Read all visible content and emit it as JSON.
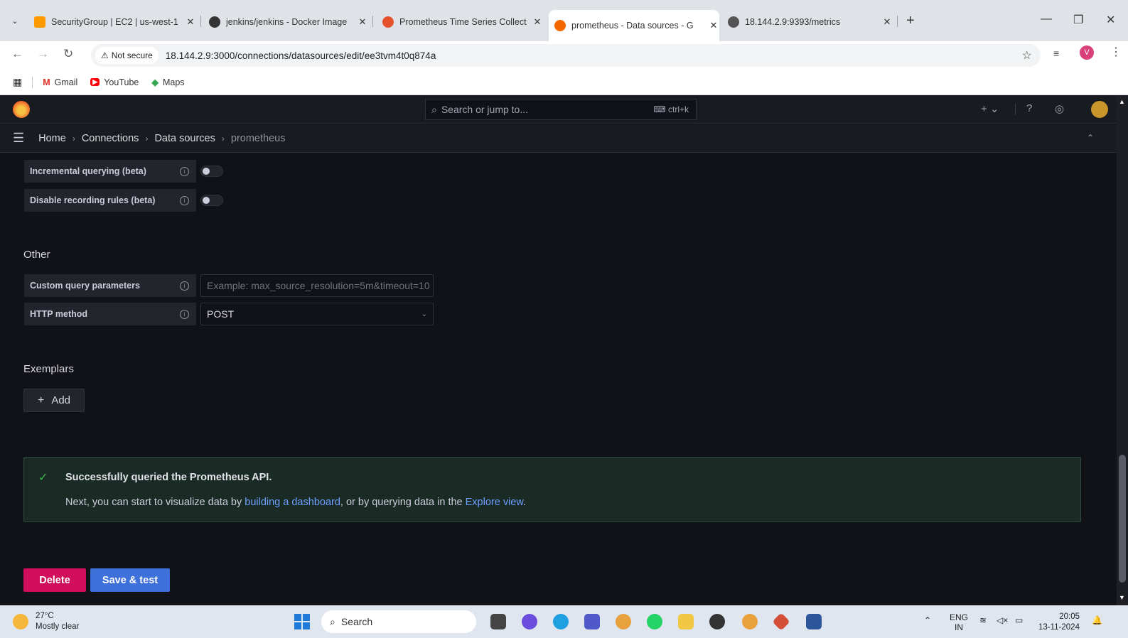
{
  "browser": {
    "tabs": [
      {
        "title": "SecurityGroup | EC2 | us-west-1",
        "close": "✕"
      },
      {
        "title": "jenkins/jenkins - Docker Image",
        "close": "✕"
      },
      {
        "title": "Prometheus Time Series Collect",
        "close": "✕"
      },
      {
        "title": "prometheus - Data sources - G",
        "close": "✕"
      },
      {
        "title": "18.144.2.9:9393/metrics",
        "close": "✕"
      }
    ],
    "new_tab": "+",
    "security_label": "Not secure",
    "url": "18.144.2.9:3000/connections/datasources/edit/ee3tvm4t0q874a",
    "profile_initial": "V",
    "bookmarks": [
      "Gmail",
      "YouTube",
      "Maps"
    ]
  },
  "grafana": {
    "search_placeholder": "Search or jump to...",
    "search_shortcut": "ctrl+k",
    "breadcrumbs": [
      "Home",
      "Connections",
      "Data sources",
      "prometheus"
    ]
  },
  "form": {
    "incremental_querying": {
      "label": "Incremental querying (beta)",
      "enabled": false
    },
    "disable_recording_rules": {
      "label": "Disable recording rules (beta)",
      "enabled": false
    },
    "other_heading": "Other",
    "custom_query": {
      "label": "Custom query parameters",
      "placeholder": "Example: max_source_resolution=5m&timeout=10"
    },
    "http_method": {
      "label": "HTTP method",
      "value": "POST"
    },
    "exemplars_heading": "Exemplars",
    "add_label": "Add"
  },
  "alert": {
    "title": "Successfully queried the Prometheus API.",
    "body_prefix": "Next, you can start to visualize data by ",
    "link1": "building a dashboard",
    "body_middle": ", or by querying data in the ",
    "link2": "Explore view",
    "body_suffix": "."
  },
  "actions": {
    "delete": "Delete",
    "save_test": "Save & test"
  },
  "taskbar": {
    "temperature": "27°C",
    "weather": "Mostly clear",
    "search": "Search",
    "lang_top": "ENG",
    "lang_bottom": "IN",
    "time": "20:05",
    "date": "13-11-2024"
  },
  "colors": {
    "accent_blue": "#3d71d9",
    "danger": "#d10e5c",
    "success": "#3fb950",
    "link": "#6e9fff"
  }
}
